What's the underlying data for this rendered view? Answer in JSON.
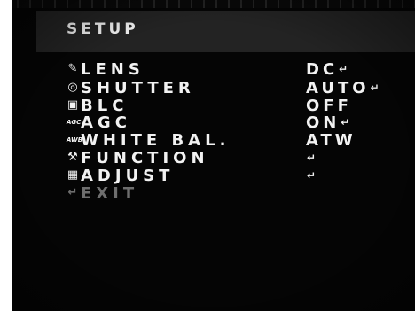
{
  "title": "SETUP",
  "menu": [
    {
      "icon": "lens-icon",
      "glyph": "✎",
      "label": "LENS",
      "value": "DC",
      "has_enter": true
    },
    {
      "icon": "shutter-icon",
      "glyph": "◎",
      "label": "SHUTTER",
      "value": "AUTO",
      "has_enter": true
    },
    {
      "icon": "blc-icon",
      "glyph": "▣",
      "label": "BLC",
      "value": "OFF",
      "has_enter": false
    },
    {
      "icon": "agc-icon",
      "glyph": "AGC",
      "label": "AGC",
      "value": "ON",
      "has_enter": true
    },
    {
      "icon": "white-balance-icon",
      "glyph": "AWB",
      "label": "WHITE BAL.",
      "value": "ATW",
      "has_enter": false
    },
    {
      "icon": "function-tools-icon",
      "glyph": "⚒",
      "label": "FUNCTION",
      "value": "",
      "has_enter": true
    },
    {
      "icon": "adjust-icon",
      "glyph": "▦",
      "label": "ADJUST",
      "value": "",
      "has_enter": true
    },
    {
      "icon": "exit-icon",
      "glyph": "↵",
      "label": "EXIT",
      "value": "",
      "has_enter": false
    }
  ],
  "enter_glyph": "↵",
  "colors": {
    "text": "#f2f2f2",
    "dim": "#6e6e6e",
    "header": "#232323",
    "background": "#050505"
  }
}
